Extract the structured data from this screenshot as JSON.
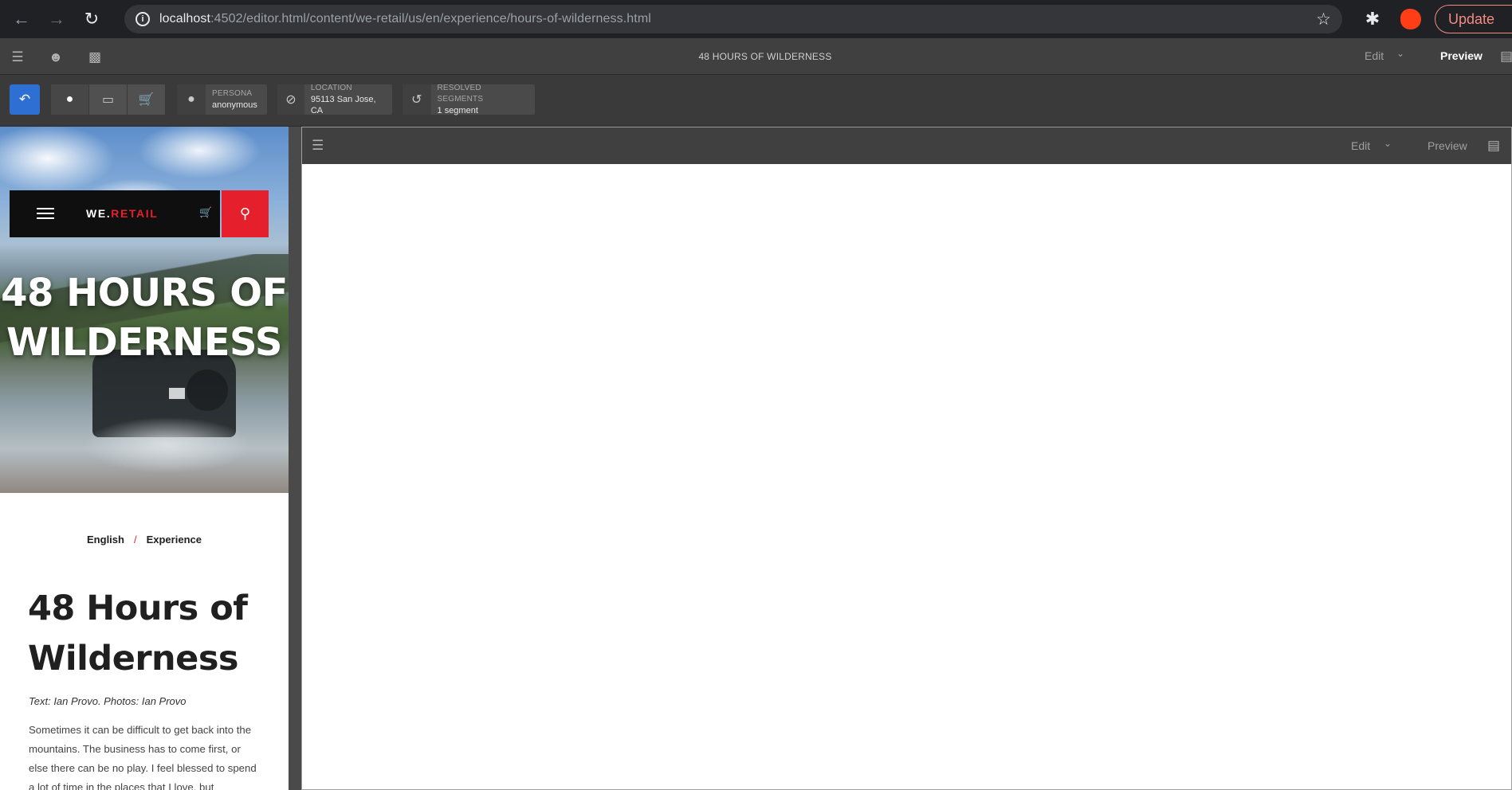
{
  "browser": {
    "url_host": "localhost",
    "url_path": ":4502/editor.html/content/we-retail/us/en/experience/hours-of-wilderness.html",
    "update_label": "Update",
    "info_glyph": "i",
    "icons": [
      "back-arrow-icon",
      "forward-arrow-icon",
      "reload-icon",
      "info-icon",
      "bookmark-star-icon",
      "extensions-puzzle-icon",
      "profile-avatar-icon"
    ]
  },
  "editor": {
    "page_title": "48 HOURS OF WILDERNESS",
    "mode_label": "Edit",
    "preview_label": "Preview",
    "icons": [
      "page-properties-icon",
      "persona-group-icon",
      "side-panel-icon",
      "annotate-icon"
    ]
  },
  "targeting": {
    "persona_label": "PERSONA",
    "persona_value": "anonymous",
    "location_label": "LOCATION",
    "location_value": "95113 San Jose, CA",
    "segments_label": "RESOLVED SEGMENTS",
    "segments_value": "1 segment",
    "colors": {
      "active": "#2d6fd3"
    }
  },
  "left_page": {
    "brand_prefix": "WE.",
    "brand_accent": "RETAIL",
    "hero_title_line1": "48 HOURS OF",
    "hero_title_line2": "WILDERNESS",
    "breadcrumb": [
      "English",
      "Experience"
    ],
    "breadcrumb_sep": "/",
    "article_title_line1": "48 Hours of",
    "article_title_line2": "Wilderness",
    "byline": "Text: Ian Provo. Photos: Ian Provo",
    "body": "Sometimes it can be difficult to get back into the mountains. The business has to come first, or else there can be no play. I feel blessed to spend a lot of time in the places that I love, but",
    "colors": {
      "accent": "#e51f2b"
    }
  },
  "right_frame": {
    "mode_label": "Edit",
    "preview_label": "Preview"
  }
}
